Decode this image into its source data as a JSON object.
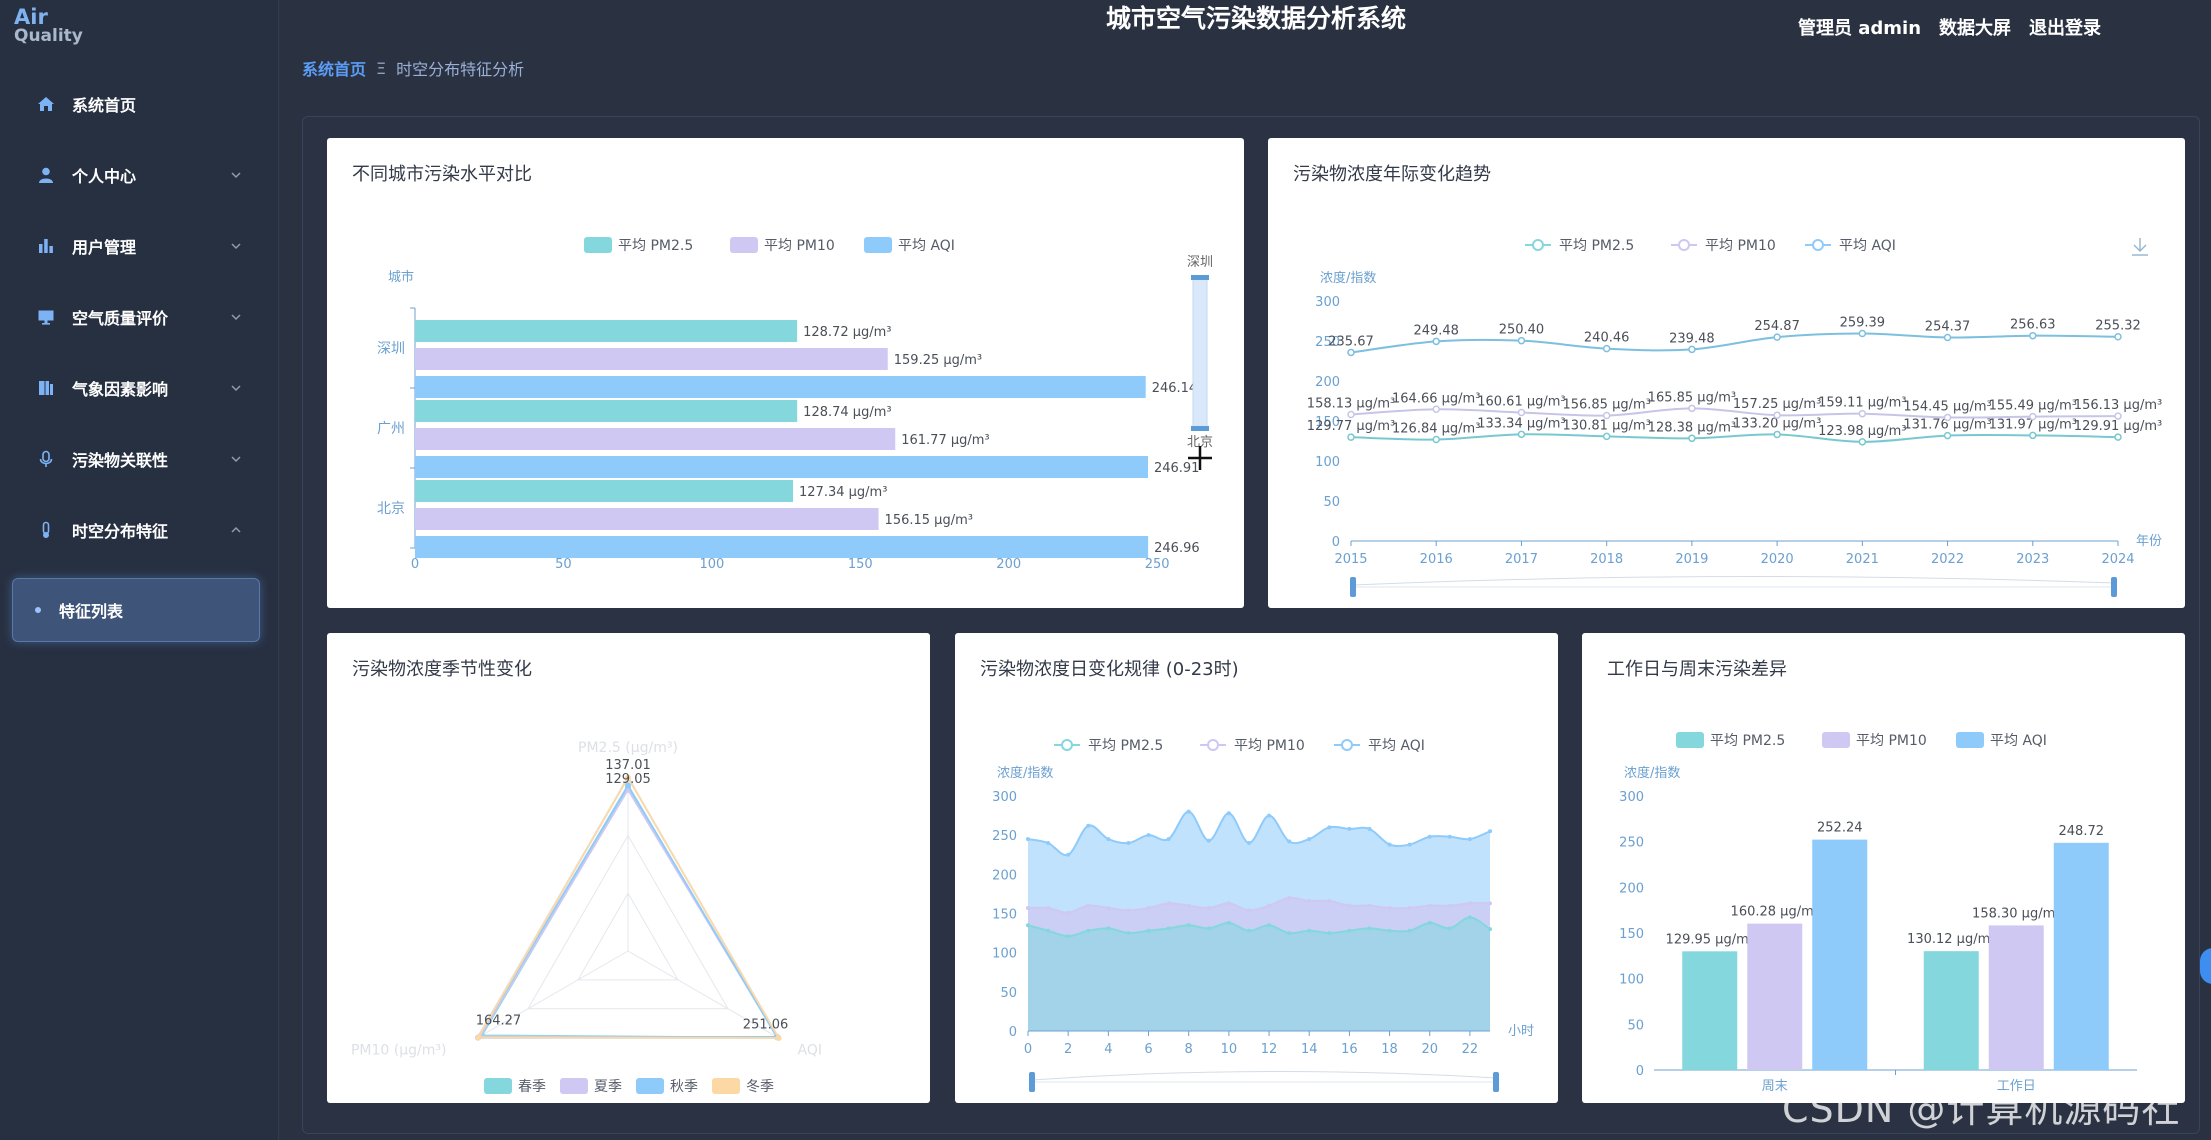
{
  "logo": {
    "line1": "Air",
    "line2": "Quality"
  },
  "header": {
    "title": "城市空气污染数据分析系统",
    "user": "管理员 admin",
    "screen": "数据大屏",
    "logout": "退出登录"
  },
  "breadcrumb": {
    "home": "系统首页",
    "sep": "Ξ",
    "current": "时空分布特征分析"
  },
  "menu": [
    {
      "label": "系统首页",
      "icon": "home-icon"
    },
    {
      "label": "个人中心",
      "icon": "user-icon"
    },
    {
      "label": "用户管理",
      "icon": "bar-chart-icon"
    },
    {
      "label": "空气质量评价",
      "icon": "monitor-icon"
    },
    {
      "label": "气象因素影响",
      "icon": "book-icon"
    },
    {
      "label": "污染物关联性",
      "icon": "microphone-icon"
    },
    {
      "label": "时空分布特征",
      "icon": "thermometer-icon"
    }
  ],
  "submenu": {
    "label": "特征列表"
  },
  "colors": {
    "pm25": "#84d7dd",
    "pm10": "#cec8f2",
    "aqi": "#8ecbfb",
    "winter": "#fcd8a4"
  },
  "cards": {
    "city": "不同城市污染水平对比",
    "yearly": "污染物浓度年际变化趋势",
    "season": "污染物浓度季节性变化",
    "hourly": "污染物浓度日变化规律 (0-23时)",
    "week": "工作日与周末污染差异"
  },
  "legend": {
    "pm25": "平均 PM2.5",
    "pm10": "平均 PM10",
    "aqi": "平均 AQI"
  },
  "chart_data": [
    {
      "type": "bar",
      "title": "不同城市污染水平对比",
      "orientation": "horizontal",
      "ylabel": "城市",
      "categories": [
        "深圳",
        "广州",
        "北京"
      ],
      "series": [
        {
          "name": "平均 PM2.5",
          "values": [
            128.72,
            128.74,
            127.34
          ],
          "labels": [
            "128.72 μg/m³",
            "128.74 μg/m³",
            "127.34 μg/m³"
          ]
        },
        {
          "name": "平均 PM10",
          "values": [
            159.25,
            161.77,
            156.15
          ],
          "labels": [
            "159.25 μg/m³",
            "161.77 μg/m³",
            "156.15 μg/m³"
          ]
        },
        {
          "name": "平均 AQI",
          "values": [
            246.14,
            246.91,
            246.96
          ],
          "labels": [
            "246.14",
            "246.91",
            "246.96"
          ]
        }
      ],
      "xticks": [
        "0",
        "50",
        "100",
        "150",
        "200",
        "250"
      ],
      "xlim": [
        0,
        255
      ],
      "zoom_labels": [
        "深圳",
        "北京"
      ]
    },
    {
      "type": "line",
      "title": "污染物浓度年际变化趋势",
      "ylabel": "浓度/指数",
      "xlabel": "年份",
      "x": [
        "2015",
        "2016",
        "2017",
        "2018",
        "2019",
        "2020",
        "2021",
        "2022",
        "2023",
        "2024"
      ],
      "series": [
        {
          "name": "平均 PM2.5",
          "values": [
            129.77,
            126.84,
            133.34,
            130.81,
            128.38,
            133.2,
            123.98,
            131.76,
            131.97,
            129.91
          ],
          "labels": [
            "129.77 μg/m³",
            "126.84 μg/m³",
            "133.34 μg/m³",
            "130.81 μg/m³",
            "128.38 μg/m³",
            "133.20 μg/m³",
            "123.98 μg/m³",
            "131.76 μg/m³",
            "131.97 μg/m³",
            "129.91 μg/m³"
          ]
        },
        {
          "name": "平均 PM10",
          "values": [
            158.13,
            164.66,
            160.61,
            156.85,
            165.85,
            157.25,
            159.11,
            154.45,
            155.49,
            156.13
          ],
          "labels": [
            "158.13 μg/m³",
            "164.66 μg/m³",
            "160.61 μg/m³",
            "156.85 μg/m³",
            "165.85 μg/m³",
            "157.25 μg/m³",
            "159.11 μg/m³",
            "154.45 μg/m³",
            "155.49 μg/m³",
            "156.13 μg/m³"
          ]
        },
        {
          "name": "平均 AQI",
          "values": [
            235.67,
            249.48,
            250.4,
            240.46,
            239.48,
            254.87,
            259.39,
            254.37,
            256.63,
            255.32
          ],
          "labels": [
            "235.67",
            "249.48",
            "250.40",
            "240.46",
            "239.48",
            "254.87",
            "259.39",
            "254.37",
            "256.63",
            "255.32"
          ]
        }
      ],
      "yticks": [
        "0",
        "50",
        "100",
        "150",
        "200",
        "250",
        "300"
      ],
      "ylim": [
        0,
        300
      ]
    },
    {
      "type": "radar",
      "title": "污染物浓度季节性变化",
      "indicators": [
        "PM2.5 (μg/m³)",
        "PM10 (μg/m³)",
        "AQI"
      ],
      "max": 260,
      "series": [
        {
          "name": "春季",
          "values": [
            129.05,
            160.0,
            251.06
          ]
        },
        {
          "name": "夏季",
          "values": [
            127.5,
            162.0,
            250.0
          ]
        },
        {
          "name": "秋季",
          "values": [
            131.0,
            164.27,
            249.0
          ]
        },
        {
          "name": "冬季",
          "values": [
            137.01,
            164.0,
            252.0
          ]
        }
      ],
      "value_labels": [
        "137.01",
        "129.05",
        "164.27",
        "251.06"
      ]
    },
    {
      "type": "area",
      "title": "污染物浓度日变化规律 (0-23时)",
      "ylabel": "浓度/指数",
      "xlabel": "小时",
      "x": [
        0,
        1,
        2,
        3,
        4,
        5,
        6,
        7,
        8,
        9,
        10,
        11,
        12,
        13,
        14,
        15,
        16,
        17,
        18,
        19,
        20,
        21,
        22,
        23
      ],
      "xticks": [
        "0",
        "2",
        "4",
        "6",
        "8",
        "10",
        "12",
        "14",
        "16",
        "18",
        "20",
        "22"
      ],
      "series": [
        {
          "name": "平均 PM2.5",
          "values": [
            135,
            128,
            121,
            128,
            131,
            125,
            128,
            131,
            135,
            131,
            138,
            128,
            135,
            125,
            128,
            125,
            128,
            131,
            128,
            128,
            138,
            131,
            145,
            130
          ]
        },
        {
          "name": "平均 PM10",
          "values": [
            157,
            157,
            151,
            160,
            157,
            154,
            157,
            163,
            160,
            157,
            163,
            154,
            160,
            170,
            166,
            166,
            160,
            160,
            157,
            157,
            160,
            160,
            163,
            163
          ]
        },
        {
          "name": "平均 AQI",
          "values": [
            245,
            240,
            225,
            262,
            245,
            240,
            250,
            245,
            280,
            243,
            278,
            240,
            275,
            242,
            245,
            260,
            258,
            258,
            238,
            238,
            248,
            248,
            245,
            255
          ]
        }
      ],
      "yticks": [
        "0",
        "50",
        "100",
        "150",
        "200",
        "250",
        "300"
      ],
      "ylim": [
        0,
        300
      ]
    },
    {
      "type": "bar",
      "title": "工作日与周末污染差异",
      "ylabel": "浓度/指数",
      "categories": [
        "周末",
        "工作日"
      ],
      "series": [
        {
          "name": "平均 PM2.5",
          "values": [
            129.95,
            130.12
          ],
          "labels": [
            "129.95 μg/m³",
            "130.12 μg/m³"
          ]
        },
        {
          "name": "平均 PM10",
          "values": [
            160.28,
            158.3
          ],
          "labels": [
            "160.28 μg/m³",
            "158.30 μg/m³"
          ]
        },
        {
          "name": "平均 AQI",
          "values": [
            252.24,
            248.72
          ],
          "labels": [
            "252.24",
            "248.72"
          ]
        }
      ],
      "yticks": [
        "0",
        "50",
        "100",
        "150",
        "200",
        "250",
        "300"
      ],
      "ylim": [
        0,
        300
      ]
    }
  ],
  "watermark": "CSDN @计算机源码社"
}
